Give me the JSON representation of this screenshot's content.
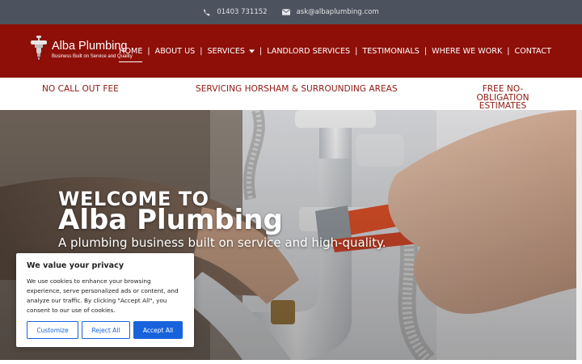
{
  "topbar": {
    "phone": "01403 731152",
    "email": "ask@albaplumbing.com"
  },
  "logo": {
    "name": "Alba Plumbing",
    "tagline": "Business Built on Service and Quality"
  },
  "nav": {
    "items": [
      {
        "label": "HOME",
        "active": true
      },
      {
        "label": "ABOUT US"
      },
      {
        "label": "SERVICES",
        "has_dropdown": true
      },
      {
        "label": "LANDLORD SERVICES"
      },
      {
        "label": "TESTIMONIALS"
      },
      {
        "label": "WHERE WE WORK"
      },
      {
        "label": "CONTACT"
      }
    ]
  },
  "usp": {
    "left": "NO CALL OUT FEE",
    "center": "SERVICING HORSHAM & SURROUNDING AREAS",
    "right_line1": "FREE NO-OBLIGATION",
    "right_line2": "ESTIMATES"
  },
  "hero": {
    "welcome": "WELCOME TO",
    "brand": "Alba Plumbing",
    "tagline": "A plumbing business built on service and high-quality."
  },
  "cookie": {
    "title": "We value your privacy",
    "text": "We use cookies to enhance your browsing experience, serve personalized ads or content, and analyze our traffic. By clicking \"Accept All\", you consent to our use of cookies.",
    "customize": "Customize",
    "reject": "Reject All",
    "accept": "Accept All"
  },
  "colors": {
    "topbar": "#4d535e",
    "header": "#8e0f08",
    "usp_text": "#8e1a11",
    "button_blue": "#1863dc",
    "pipe_wrench": "#e8542a"
  }
}
